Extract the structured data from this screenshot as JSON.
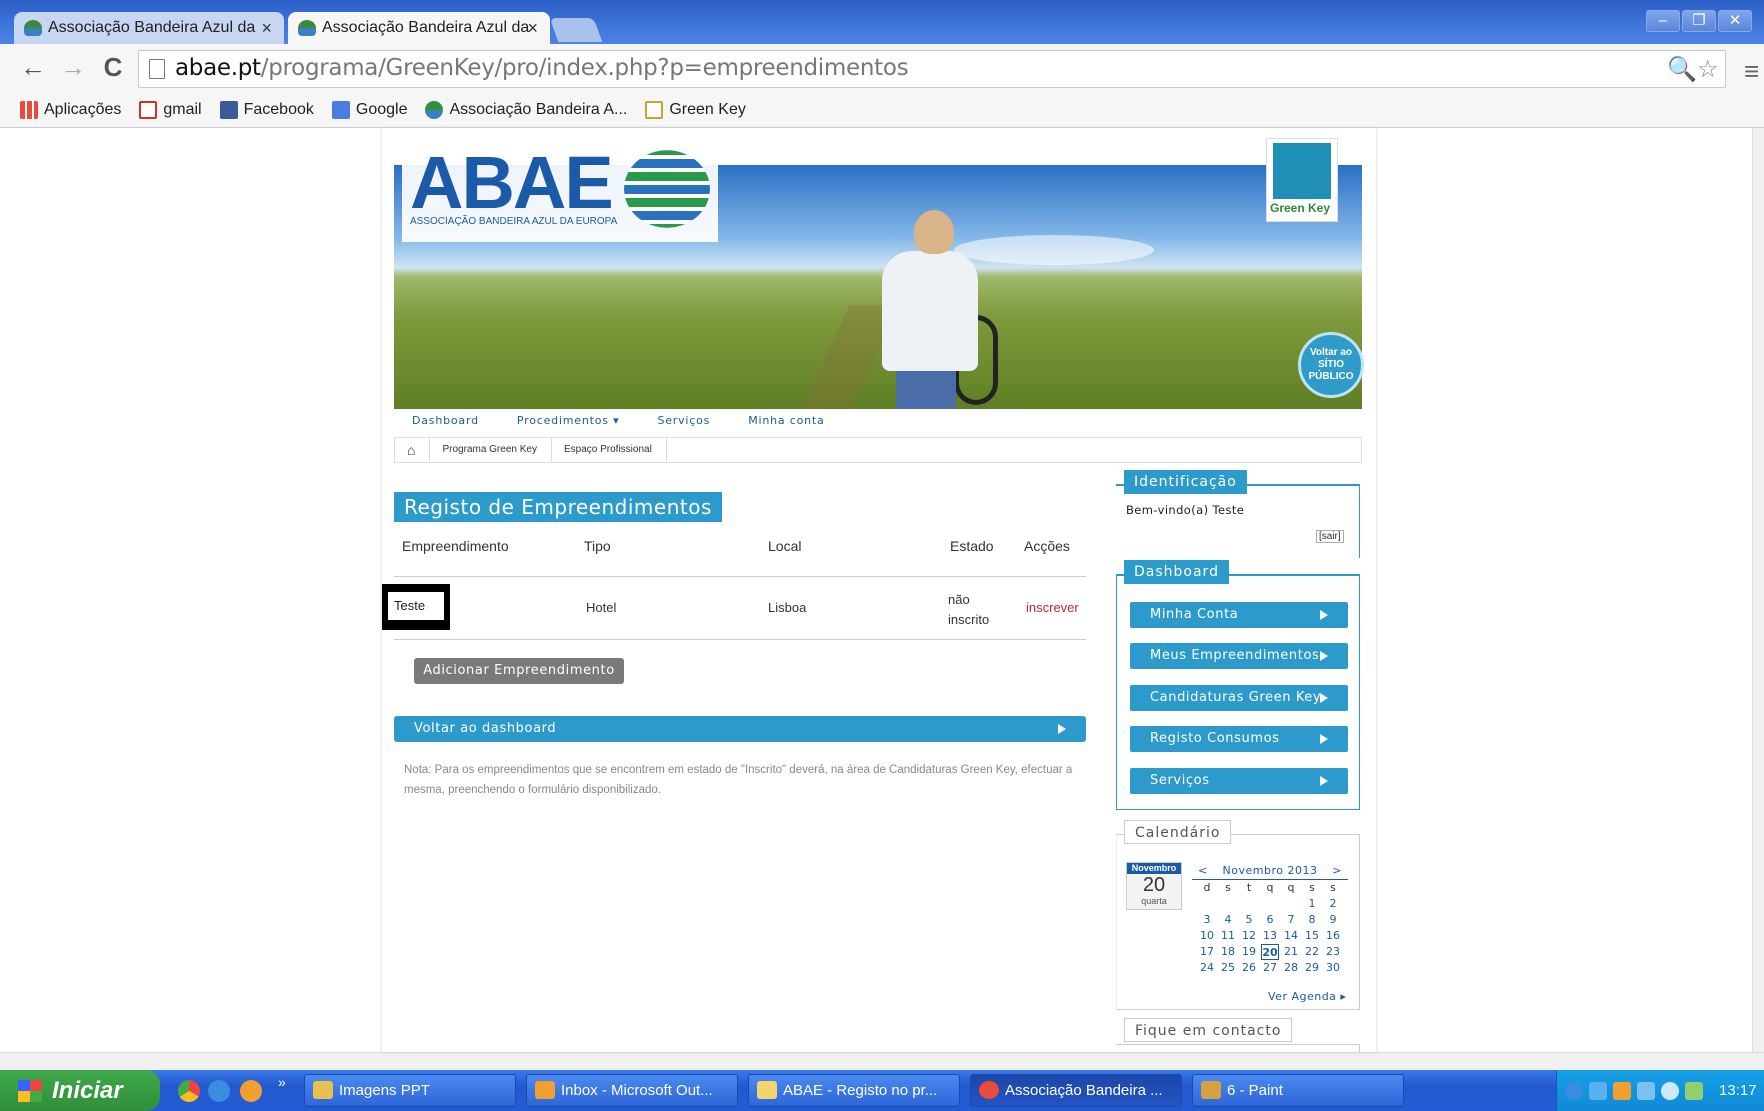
{
  "browser": {
    "tabs": [
      {
        "title": "Associação Bandeira Azul da",
        "close": "×"
      },
      {
        "title": "Associação Bandeira Azul da",
        "close": "×"
      }
    ],
    "url_host": "abae.pt",
    "url_path": "/programa/GreenKey/pro/index.php?p=empreendimentos",
    "window_buttons": [
      "–",
      "❐",
      "✕"
    ],
    "nav_icons": {
      "back": "←",
      "forward": "→",
      "reload": "C",
      "menu": "≡",
      "zoom": "🔍",
      "star": "☆"
    },
    "bookmarks": [
      {
        "label": "Aplicações",
        "icon": "apps-icon",
        "color": "#e94b3c"
      },
      {
        "label": "gmail",
        "icon": "gmail-icon",
        "color": "#d93025"
      },
      {
        "label": "Facebook",
        "icon": "facebook-icon",
        "color": "#3b5998"
      },
      {
        "label": "Google",
        "icon": "google-icon",
        "color": "#4a7de2"
      },
      {
        "label": "Associação Bandeira A...",
        "icon": "abae-icon",
        "color": "#2f8f3a"
      },
      {
        "label": "Green Key",
        "icon": "folder-icon",
        "color": "#e7c14b"
      }
    ]
  },
  "site": {
    "logo_text": "ABAE",
    "logo_sub": "ASSOCIAÇÃO BANDEIRA AZUL DA EUROPA",
    "greenkey_label": "Green Key",
    "voltar_lines": [
      "Voltar ao",
      "SÍTIO",
      "PÚBLICO"
    ],
    "nav": [
      "Dashboard",
      "Procedimentos ▾",
      "Serviços",
      "Minha conta"
    ],
    "breadcrumbs": [
      "⌂",
      "Programa Green Key",
      "Espaço Profissional"
    ]
  },
  "main": {
    "title": "Registo de Empreendimentos",
    "columns": [
      "Empreendimento",
      "Tipo",
      "Local",
      "Estado",
      "Acções"
    ],
    "row": {
      "empreendimento": "Teste",
      "tipo": "Hotel",
      "local": "Lisboa",
      "estado_l1": "não",
      "estado_l2": "inscrito",
      "acao": "inscrever"
    },
    "add_button": "Adicionar Empreendimento",
    "back_button": "Voltar ao dashboard",
    "nota": "Nota: Para os empreendimentos que se encontrem em estado de \"Inscrito\" deverá, na área de Candidaturas Green Key, efectuar a mesma, preenchendo o formulário disponibilizado."
  },
  "sidebar": {
    "identificacao_title": "Identificação",
    "welcome": "Bem-vindo(a) Teste",
    "sair": "[sair]",
    "dashboard_title": "Dashboard",
    "buttons": [
      "Minha Conta",
      "Meus Empreendimentos",
      "Candidaturas Green Key",
      "Registo Consumos",
      "Serviços"
    ],
    "calendar_title": "Calendário",
    "cal_month_badge": "Novembro",
    "cal_day": "20",
    "cal_weekday": "quarta",
    "cal_header": {
      "prev": "<",
      "label": "Novembro 2013",
      "next": ">"
    },
    "cal_weekdays": [
      "d",
      "s",
      "t",
      "q",
      "q",
      "s",
      "s"
    ],
    "cal_weeks": [
      [
        "",
        "",
        "",
        "",
        "",
        "1",
        "2"
      ],
      [
        "3",
        "4",
        "5",
        "6",
        "7",
        "8",
        "9"
      ],
      [
        "10",
        "11",
        "12",
        "13",
        "14",
        "15",
        "16"
      ],
      [
        "17",
        "18",
        "19",
        "20",
        "21",
        "22",
        "23"
      ],
      [
        "24",
        "25",
        "26",
        "27",
        "28",
        "29",
        "30"
      ]
    ],
    "ver_agenda": "Ver Agenda ▸",
    "contacto_title": "Fique em contacto"
  },
  "taskbar": {
    "start": "Iniciar",
    "more": "»",
    "tasks": [
      {
        "label": "Imagens PPT",
        "color": "#e7c14b"
      },
      {
        "label": "Inbox - Microsoft Out...",
        "color": "#f0a030"
      },
      {
        "label": "ABAE - Registo no pr...",
        "color": "#f5d56a"
      },
      {
        "label": "Associação Bandeira ...",
        "color": "#e94b3c"
      },
      {
        "label": "6 - Paint",
        "color": "#d8a040"
      }
    ],
    "clock": "13:17"
  }
}
